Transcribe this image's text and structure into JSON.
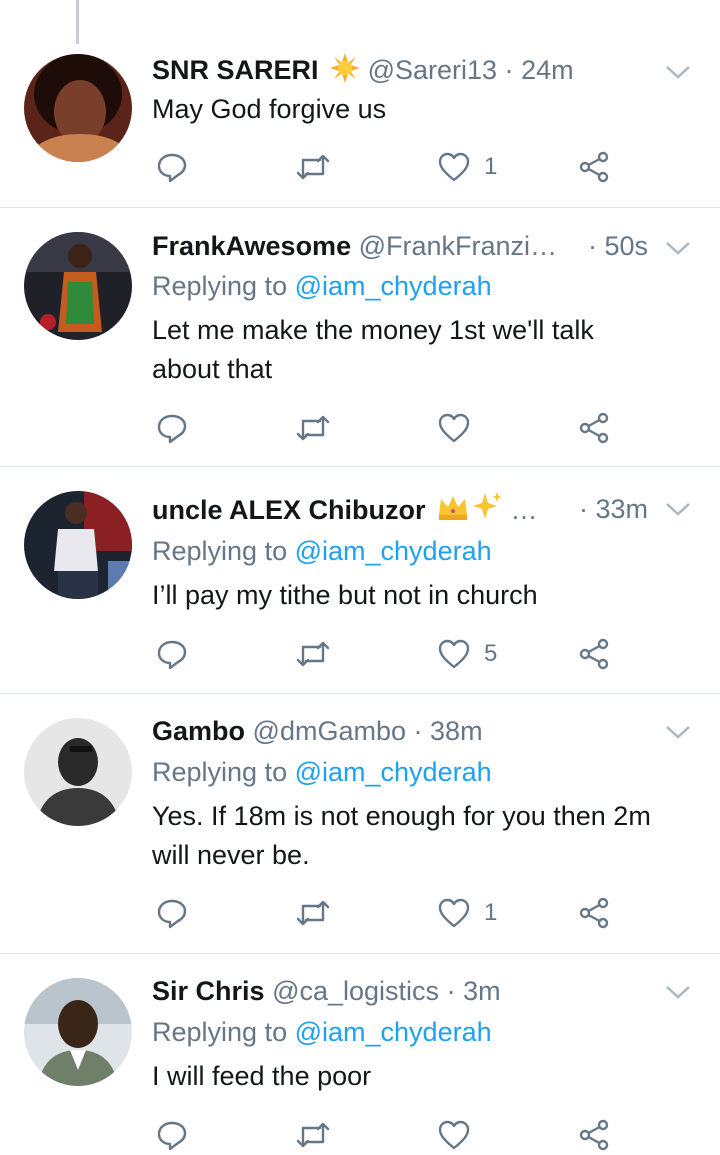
{
  "tweets": [
    {
      "name": "SNR SARERI",
      "emoji": "sun-icon",
      "handle": "@Sareri13",
      "separator": "·",
      "time": "24m",
      "replying_prefix": "",
      "replying_to": "",
      "text": "May God forgive us",
      "likes": "1"
    },
    {
      "name": "FrankAwesome",
      "handle": "@FrankFranzi…",
      "separator": "·",
      "time": "50s",
      "replying_prefix": "Replying to",
      "replying_to": "@iam_chyderah",
      "text": "Let me make the money 1st we'll talk about that",
      "likes": ""
    },
    {
      "name": "uncle ALEX Chibuzor",
      "emoji": "crown-sparkles-icon",
      "handle": "…",
      "separator": "·",
      "time": "33m",
      "replying_prefix": "Replying to",
      "replying_to": "@iam_chyderah",
      "text": "I’ll pay my tithe but not in church",
      "likes": "5"
    },
    {
      "name": "Gambo",
      "handle": "@dmGambo",
      "separator": "·",
      "time": "38m",
      "replying_prefix": "Replying to",
      "replying_to": "@iam_chyderah",
      "text": "Yes. If 18m is not enough for you then 2m will never be.",
      "likes": "1"
    },
    {
      "name": "Sir Chris",
      "handle": "@ca_logistics",
      "separator": "·",
      "time": "3m",
      "replying_prefix": "Replying to",
      "replying_to": "@iam_chyderah",
      "text": "I will feed the poor",
      "likes": ""
    }
  ],
  "colors": {
    "accent": "#1da1f2",
    "secondary_text": "#657786",
    "primary_text": "#14171a",
    "divider": "#e1e8ed",
    "icon": "#657786"
  }
}
